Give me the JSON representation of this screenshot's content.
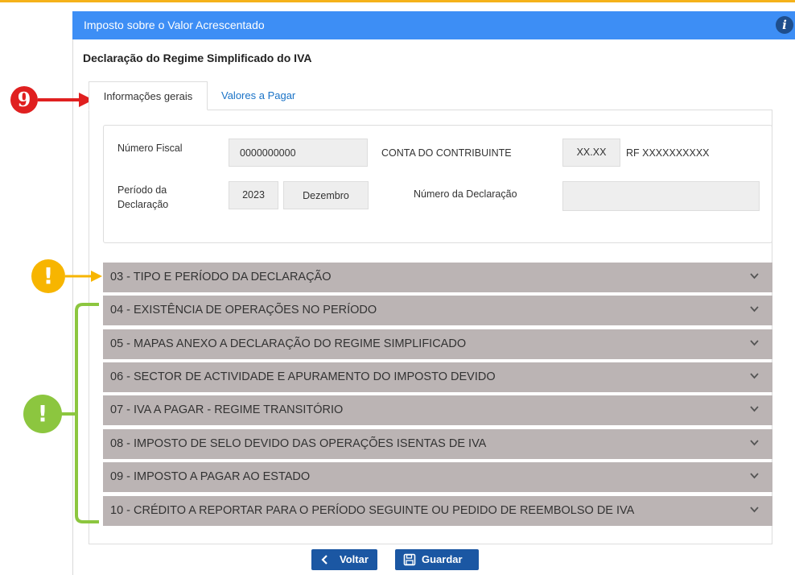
{
  "header": {
    "title": "Imposto sobre o Valor Acrescentado",
    "info_icon": "info-icon",
    "color": "#3d8ef5"
  },
  "page": {
    "subtitle": "Declaração do Regime Simplificado do IVA"
  },
  "tabs": [
    {
      "label": "Informações gerais",
      "active": true
    },
    {
      "label": "Valores a Pagar",
      "active": false
    }
  ],
  "form": {
    "numero_fiscal_label": "Número Fiscal",
    "numero_fiscal_value": "0000000000",
    "conta_label": "CONTA DO CONTRIBUINTE",
    "conta_value": "XX.XX",
    "rf_value": "RF XXXXXXXXXX",
    "periodo_label": "Período da Declaração",
    "periodo_ano": "2023",
    "periodo_mes": "Dezembro",
    "num_declaracao_label": "Número da Declaração",
    "num_declaracao_value": ""
  },
  "sections": [
    "03 - TIPO E PERÍODO DA DECLARAÇÃO",
    "04 - EXISTÊNCIA DE OPERAÇÕES NO PERÍODO",
    "05 - MAPAS ANEXO A DECLARAÇÃO DO REGIME SIMPLIFICADO",
    "06 - SECTOR DE ACTIVIDADE E APURAMENTO DO IMPOSTO DEVIDO",
    "07 - IVA A PAGAR - REGIME TRANSITÓRIO",
    "08 - IMPOSTO DE SELO DEVIDO DAS OPERAÇÕES ISENTAS DE IVA",
    "09 - IMPOSTO A PAGAR AO ESTADO",
    "10 - CRÉDITO A REPORTAR PARA O PERÍODO SEGUINTE OU PEDIDO DE REEMBOLSO DE IVA"
  ],
  "buttons": {
    "back": "Voltar",
    "save": "Guardar"
  },
  "annotations": {
    "step_number": "9",
    "warning_mark": "!",
    "colors": {
      "red": "#e02020",
      "yellow": "#f7b500",
      "green": "#8cc63f"
    }
  }
}
